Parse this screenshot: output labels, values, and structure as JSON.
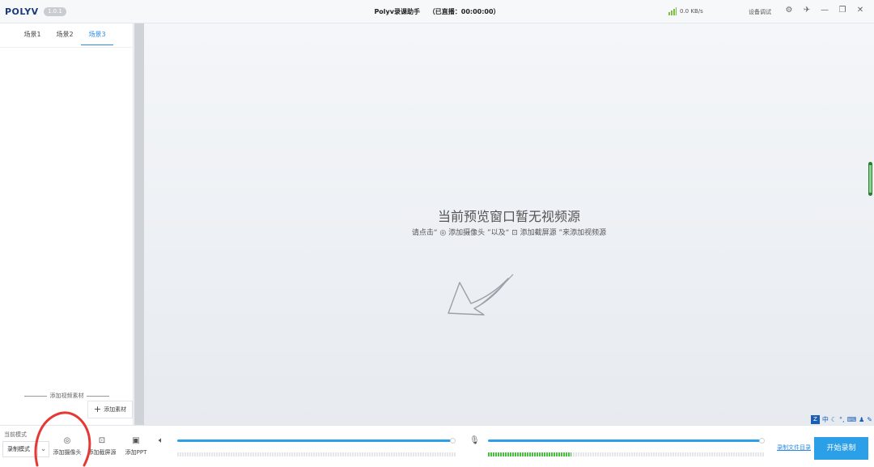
{
  "titlebar": {
    "logo": "POLYV",
    "version": "1.0.1",
    "app_name": "Polyv录课助手",
    "live_status": "（已直播：00:00:00）",
    "speed": "0.0 KB/s",
    "debug_label": "设备调试"
  },
  "sidebar": {
    "tabs": [
      {
        "label": "场景1",
        "active": false
      },
      {
        "label": "场景2",
        "active": false
      },
      {
        "label": "场景3",
        "active": true
      }
    ],
    "add_source_label": "添加视频素材",
    "add_material_label": "添加素材"
  },
  "preview": {
    "empty_title": "当前预览窗口暂无视频源",
    "hint_prefix": "请点击“",
    "hint_camera": "添加摄像头",
    "hint_middle": "”以及“",
    "hint_screen": "添加截屏源",
    "hint_suffix": "”来添加视频源"
  },
  "ime": {
    "lang": "中"
  },
  "bottombar": {
    "mode_label": "当前模式",
    "mode_value": "录制模式",
    "tools": [
      {
        "label": "添加摄像头",
        "icon": "camera-icon"
      },
      {
        "label": "添加截屏源",
        "icon": "screenshot-icon"
      },
      {
        "label": "添加PPT",
        "icon": "ppt-icon"
      }
    ],
    "speaker_volume": 0.99,
    "mic_volume": 0.99,
    "mic_level": 0.3,
    "record_dir_label": "录制文件目录",
    "start_label": "开始录制"
  },
  "colors": {
    "accent": "#2b9fe8",
    "meter_green": "#43c23c",
    "annotation_red": "#e53935"
  }
}
